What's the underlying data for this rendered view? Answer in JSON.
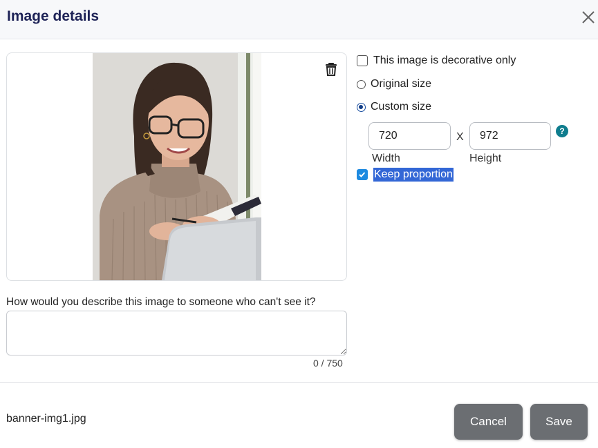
{
  "dialog": {
    "title": "Image details",
    "close_icon": "close-icon"
  },
  "preview": {
    "delete_icon": "trash-icon",
    "image_alt": "Woman with glasses writing in a notebook in front of a laptop"
  },
  "options": {
    "decorative_label": "This image is decorative only",
    "decorative_checked": false,
    "original_size_label": "Original size",
    "custom_size_label": "Custom size",
    "selected_size": "custom",
    "width_value": "720",
    "height_value": "972",
    "width_label": "Width",
    "height_label": "Height",
    "separator": "X",
    "help_icon": "?",
    "keep_proportion_label": "Keep proportion",
    "keep_proportion_checked": true
  },
  "description": {
    "label": "How would you describe this image to someone who can't see it?",
    "value": "",
    "counter": "0 / 750"
  },
  "footer": {
    "filename": "banner-img1.jpg",
    "cancel_label": "Cancel",
    "save_label": "Save"
  },
  "colors": {
    "title": "#1d2256",
    "button_bg": "#6b6e72",
    "checkbox_checked": "#1d8ae0",
    "help_icon": "#0f7d8e",
    "selection_highlight": "#3367d6"
  }
}
